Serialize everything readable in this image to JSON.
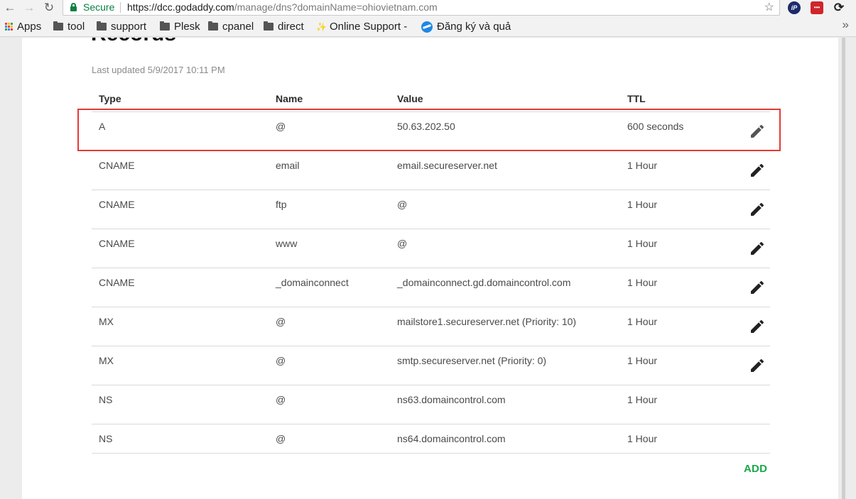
{
  "browser": {
    "secure_label": "Secure",
    "url_host": "https://dcc.godaddy.com",
    "url_path": "/manage/dns?domainName=ohiovietnam.com",
    "extensions": {
      "ip_label": "iP",
      "red_label": "•••"
    },
    "bookmarks": [
      {
        "label": "Apps",
        "icon": "apps-grid-icon"
      },
      {
        "label": "tool",
        "icon": "folder-icon"
      },
      {
        "label": "support",
        "icon": "folder-icon"
      },
      {
        "label": "Plesk",
        "icon": "folder-icon"
      },
      {
        "label": "cpanel",
        "icon": "folder-icon"
      },
      {
        "label": "direct",
        "icon": "folder-icon"
      },
      {
        "label": "Online Support -",
        "icon": "online-support-icon"
      },
      {
        "label": "Đăng ký và quả",
        "icon": "globe-icon"
      }
    ]
  },
  "dns": {
    "title": "Records",
    "last_updated": "Last updated 5/9/2017 10:11 PM",
    "columns": {
      "type": "Type",
      "name": "Name",
      "value": "Value",
      "ttl": "TTL"
    },
    "records": [
      {
        "type": "A",
        "name": "@",
        "value": "50.63.202.50",
        "ttl": "600 seconds",
        "editable": true,
        "highlighted": true
      },
      {
        "type": "CNAME",
        "name": "email",
        "value": "email.secureserver.net",
        "ttl": "1 Hour",
        "editable": true
      },
      {
        "type": "CNAME",
        "name": "ftp",
        "value": "@",
        "ttl": "1 Hour",
        "editable": true
      },
      {
        "type": "CNAME",
        "name": "www",
        "value": "@",
        "ttl": "1 Hour",
        "editable": true
      },
      {
        "type": "CNAME",
        "name": "_domainconnect",
        "value": "_domainconnect.gd.domaincontrol.com",
        "ttl": "1 Hour",
        "editable": true
      },
      {
        "type": "MX",
        "name": "@",
        "value": "mailstore1.secureserver.net (Priority: 10)",
        "ttl": "1 Hour",
        "editable": true
      },
      {
        "type": "MX",
        "name": "@",
        "value": "smtp.secureserver.net (Priority: 0)",
        "ttl": "1 Hour",
        "editable": true
      },
      {
        "type": "NS",
        "name": "@",
        "value": "ns63.domaincontrol.com",
        "ttl": "1 Hour",
        "editable": false
      },
      {
        "type": "NS",
        "name": "@",
        "value": "ns64.domaincontrol.com",
        "ttl": "1 Hour",
        "editable": false
      }
    ],
    "add_label": "ADD"
  },
  "colors": {
    "secure_green": "#0b8043",
    "add_green": "#1aa84a",
    "highlight_red": "#e53935"
  }
}
